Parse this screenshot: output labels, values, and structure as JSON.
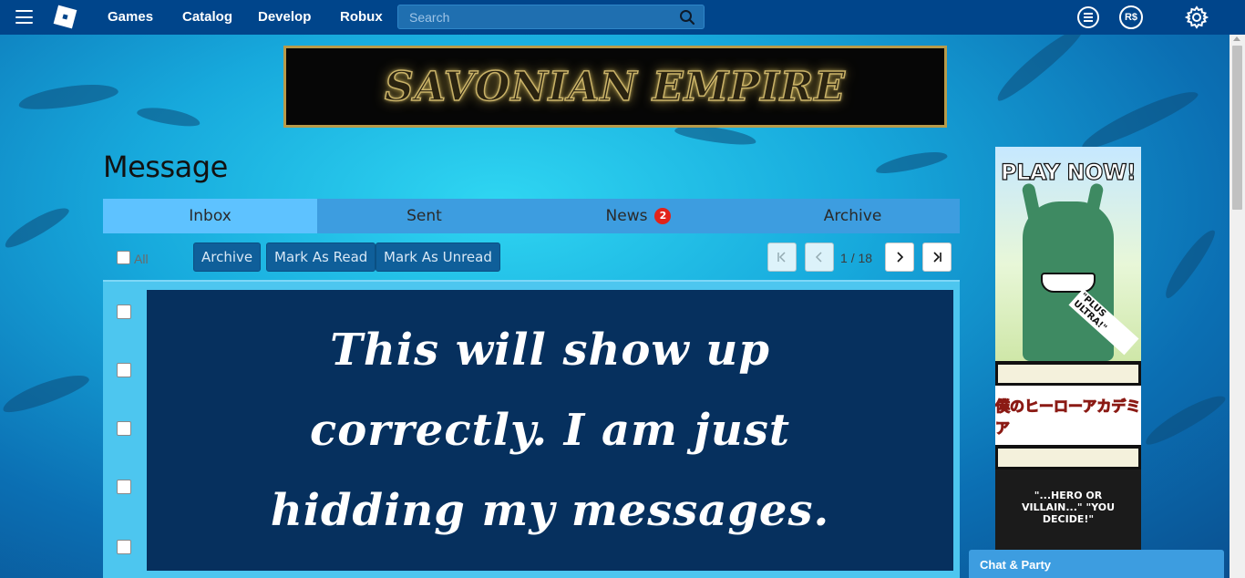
{
  "nav": {
    "links": [
      "Games",
      "Catalog",
      "Develop",
      "Robux"
    ],
    "search_placeholder": "Search",
    "robux_icon_text": "R$"
  },
  "banner": {
    "text": "SAVONIAN EMPIRE"
  },
  "page": {
    "title": "Message"
  },
  "tabs": [
    {
      "label": "Inbox",
      "active": true
    },
    {
      "label": "Sent",
      "active": false
    },
    {
      "label": "News",
      "active": false,
      "badge": "2"
    },
    {
      "label": "Archive",
      "active": false
    }
  ],
  "actions": {
    "select_all_label": "All",
    "archive": "Archive",
    "mark_read": "Mark As Read",
    "mark_unread": "Mark As Unread"
  },
  "pager": {
    "current": "1",
    "separator": "/",
    "total": "18"
  },
  "overlay": {
    "text": "This will show up correctly. I am just hidding my messages."
  },
  "ad": {
    "headline": "PLAY NOW!",
    "tagline": "\"PLUS ULTRA!\"",
    "logo_text": "僕のヒーローアカデミア",
    "bottom_text": "\"...HERO OR VILLAIN...\" \"YOU DECIDE!\""
  },
  "chat": {
    "label": "Chat & Party"
  },
  "colors": {
    "nav_bg": "#00458b",
    "tab_active": "#5ec2ff",
    "tab_bg": "#3d9de0",
    "overlay_bg": "#06305e",
    "badge": "#e2231a"
  }
}
